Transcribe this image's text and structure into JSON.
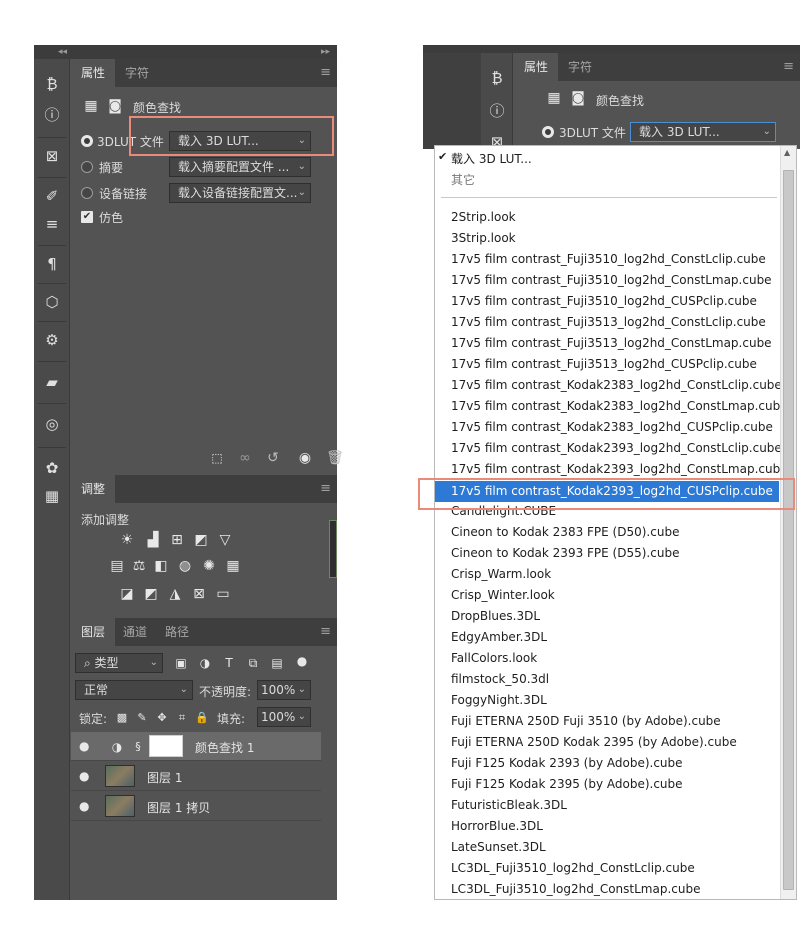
{
  "left": {
    "panel1": {
      "tabs": [
        "属性",
        "字符"
      ],
      "title": "颜色查找",
      "rows": [
        {
          "label": "3DLUT 文件",
          "value": "载入 3D LUT..."
        },
        {
          "label": "摘要",
          "value": "载入摘要配置文件 ..."
        },
        {
          "label": "设备链接",
          "value": "载入设备链接配置文..."
        }
      ],
      "dither_label": "仿色"
    },
    "panel2": {
      "tab": "调整",
      "subtitle": "添加调整"
    },
    "panel3": {
      "tabs": [
        "图层",
        "通道",
        "路径"
      ],
      "filter_label": "类型",
      "blend_mode": "正常",
      "opacity_label": "不透明度:",
      "opacity_value": "100%",
      "lock_label": "锁定:",
      "fill_label": "填充:",
      "fill_value": "100%",
      "layers": [
        "颜色查找 1",
        "图层 1",
        "图层 1 拷贝"
      ]
    }
  },
  "right": {
    "tabs": [
      "属性",
      "字符"
    ],
    "title": "颜色查找",
    "row_label": "3DLUT 文件",
    "dropdown_value": "载入 3D LUT...",
    "menu_top": [
      {
        "label": "载入 3D LUT...",
        "checked": true
      },
      {
        "label": "其它",
        "checked": false
      }
    ],
    "menu_items": [
      "2Strip.look",
      "3Strip.look",
      "17v5 film contrast_Fuji3510_log2hd_ConstLclip.cube",
      "17v5 film contrast_Fuji3510_log2hd_ConstLmap.cube",
      "17v5 film contrast_Fuji3510_log2hd_CUSPclip.cube",
      "17v5 film contrast_Fuji3513_log2hd_ConstLclip.cube",
      "17v5 film contrast_Fuji3513_log2hd_ConstLmap.cube",
      "17v5 film contrast_Fuji3513_log2hd_CUSPclip.cube",
      "17v5 film contrast_Kodak2383_log2hd_ConstLclip.cube",
      "17v5 film contrast_Kodak2383_log2hd_ConstLmap.cube",
      "17v5 film contrast_Kodak2383_log2hd_CUSPclip.cube",
      "17v5 film contrast_Kodak2393_log2hd_ConstLclip.cube",
      "17v5 film contrast_Kodak2393_log2hd_ConstLmap.cube",
      "17v5 film contrast_Kodak2393_log2hd_CUSPclip.cube",
      "Candlelight.CUBE",
      "Cineon to Kodak 2383 FPE (D50).cube",
      "Cineon to Kodak 2393 FPE (D55).cube",
      "Crisp_Warm.look",
      "Crisp_Winter.look",
      "DropBlues.3DL",
      "EdgyAmber.3DL",
      "FallColors.look",
      "filmstock_50.3dl",
      "FoggyNight.3DL",
      "Fuji ETERNA 250D Fuji 3510 (by Adobe).cube",
      "Fuji ETERNA 250D Kodak 2395 (by Adobe).cube",
      "Fuji F125 Kodak 2393 (by Adobe).cube",
      "Fuji F125 Kodak 2395 (by Adobe).cube",
      "FuturisticBleak.3DL",
      "HorrorBlue.3DL",
      "LateSunset.3DL",
      "LC3DL_Fuji3510_log2hd_ConstLclip.cube",
      "LC3DL_Fuji3510_log2hd_ConstLmap.cube"
    ],
    "selected_item": "17v5 film contrast_Kodak2393_log2hd_CUSPclip.cube"
  },
  "colors": {
    "panel_bg": "#535353",
    "highlight_box": "#e98a7a",
    "selection_blue": "#2d7ad6"
  }
}
